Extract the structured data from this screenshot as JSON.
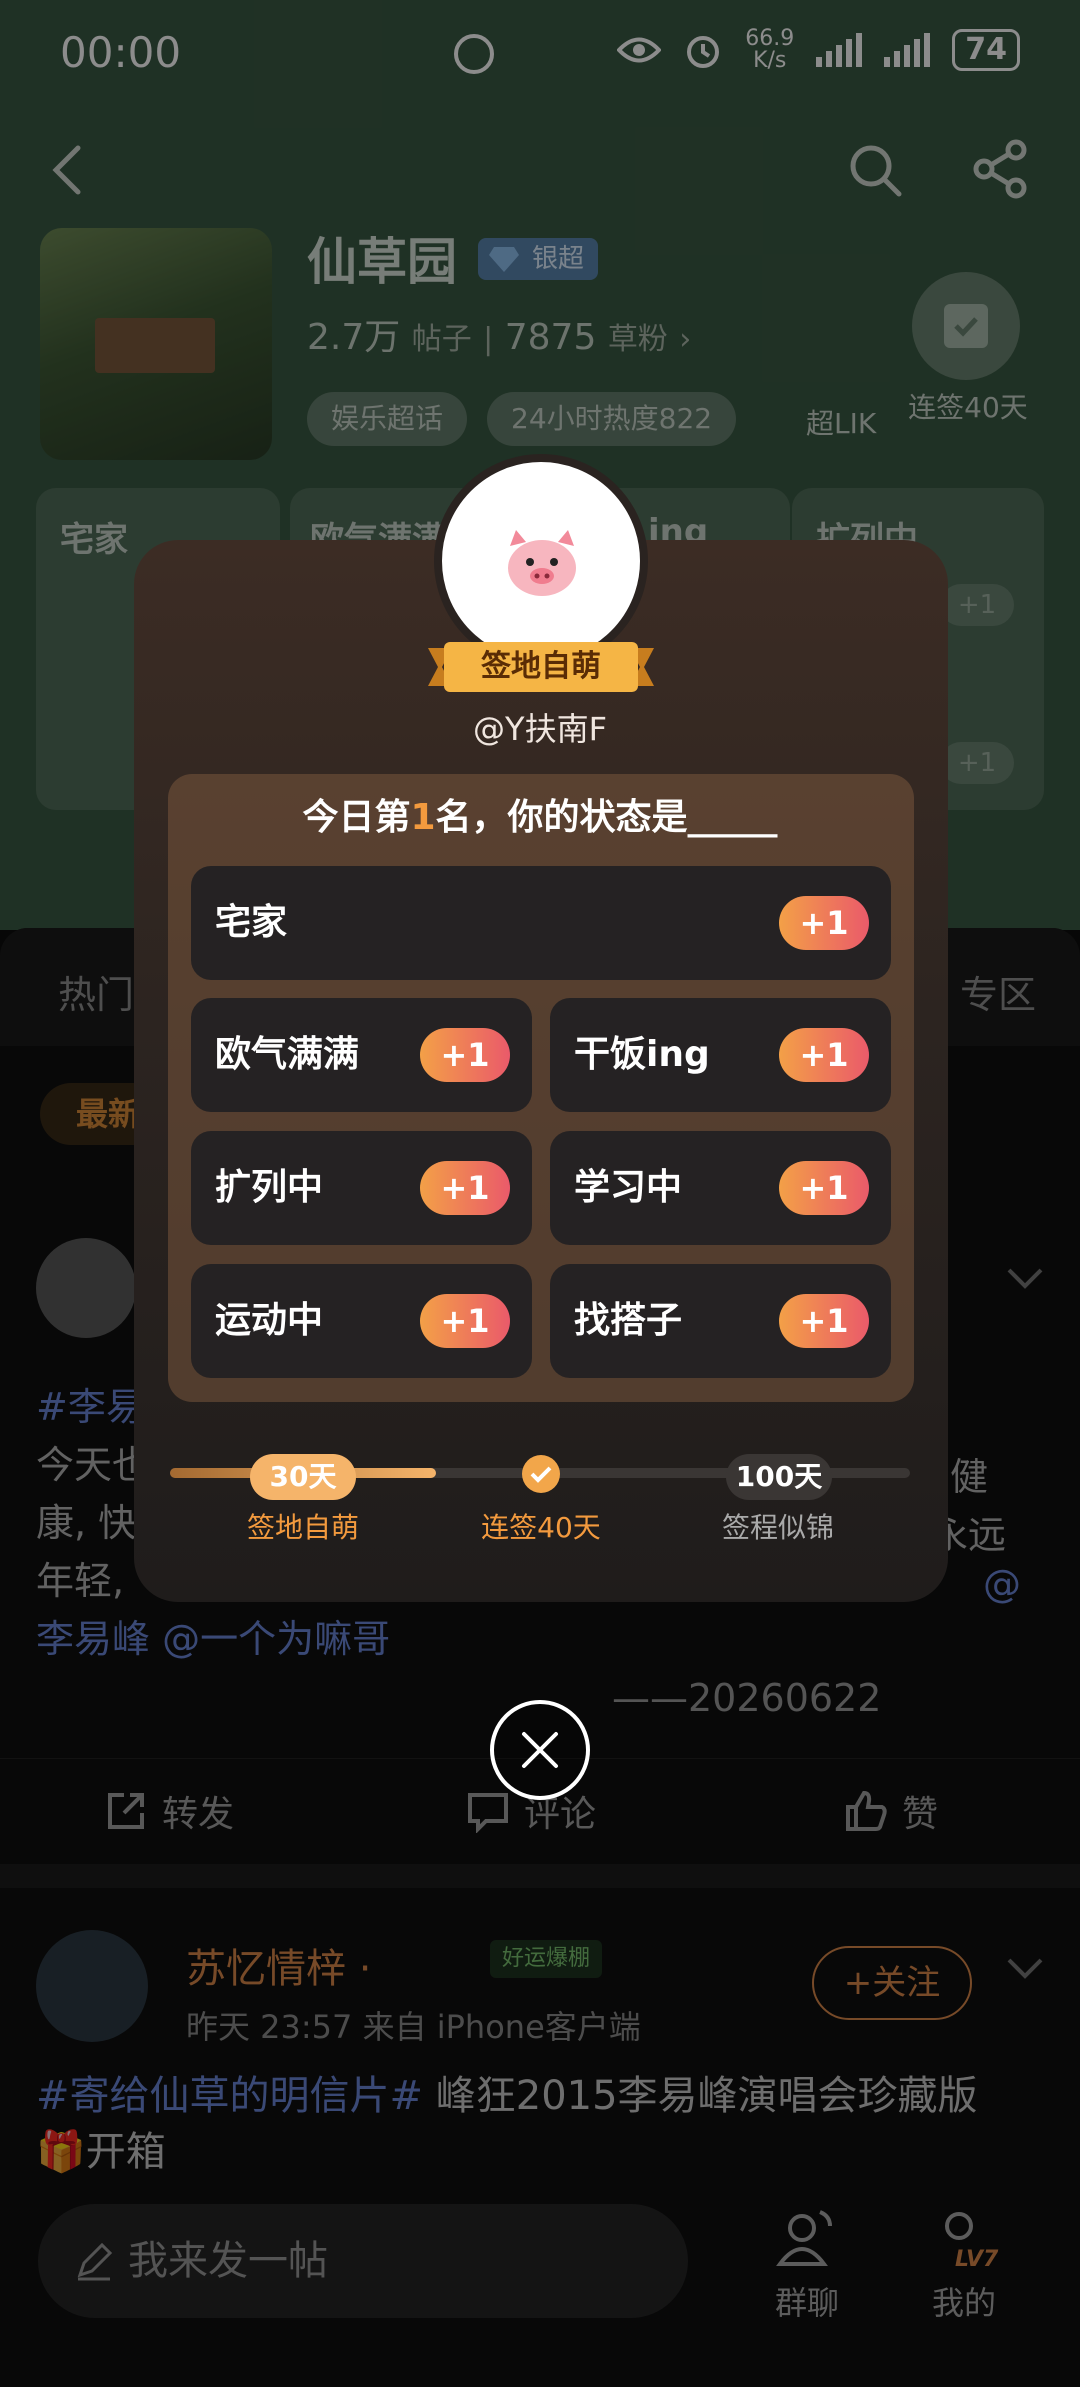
{
  "status_bar": {
    "time": "00:00",
    "speed": "66.9\nK/s",
    "speed_top": "66.9",
    "speed_bottom": "K/s",
    "battery": "74"
  },
  "community": {
    "title": "仙草园",
    "badge": "银超",
    "posts_count": "2.7万",
    "posts_label": "帖子",
    "fans_count": "7875",
    "fans_label": "草粉",
    "fans_arrow": "›",
    "tags": [
      "娱乐超话",
      "24小时热度822"
    ],
    "chaolik": "超LIK",
    "checkin_label": "连签40天"
  },
  "background_cards": {
    "col1": "宅家",
    "col2": "欧气满满",
    "col2_tail": "ing",
    "col3": "扩列中",
    "plus": "+1"
  },
  "feed": {
    "tab_hot": "热门",
    "tab_zone": "专区",
    "chip_new": "最新",
    "post1": {
      "hashtag": "#李易",
      "line1": "今天也",
      "line1_right": "健",
      "line2": "康, 快",
      "line2_right": "永远",
      "line3": "年轻,",
      "mention_tail": "@",
      "line4": "李易峰 @一个为嘛哥",
      "date": "——20260622"
    },
    "actions": {
      "repost": "转发",
      "comment": "评论",
      "like": "赞"
    },
    "post2": {
      "name": "苏忆情梓 ·",
      "lucky": "好运爆棚",
      "meta": "昨天 23:57  来自 iPhone客户端",
      "follow": "+关注",
      "hashtag": "#寄给仙草的明信片#",
      "text": " 峰狂2015李易峰演唱会珍藏版",
      "text2": "🎁开箱"
    }
  },
  "bottom_bar": {
    "compose_placeholder": "我来发一帖",
    "group_chat": "群聊",
    "mine": "我的",
    "level": "LV7"
  },
  "modal": {
    "ribbon": "签地自萌",
    "username": "@Y扶南F",
    "question_pre": "今日第",
    "rank": "1",
    "question_post": "名，你的状态是_____",
    "options": [
      {
        "label": "宅家",
        "plus": "+1"
      },
      {
        "label": "欧气满满",
        "plus": "+1"
      },
      {
        "label": "干饭ing",
        "plus": "+1"
      },
      {
        "label": "扩列中",
        "plus": "+1"
      },
      {
        "label": "学习中",
        "plus": "+1"
      },
      {
        "label": "运动中",
        "plus": "+1"
      },
      {
        "label": "找搭子",
        "plus": "+1"
      }
    ],
    "timeline": {
      "progress": 0.36,
      "node_30": "30天",
      "node_100": "100天",
      "label_30": "签地自萌",
      "label_40": "连签40天",
      "label_100": "签程似锦"
    }
  },
  "colors": {
    "accent_orange": "#f39a3e",
    "plus_gradient_start": "#f3a047",
    "plus_gradient_end": "#ea5a6a",
    "hashtag_blue": "#6a86d8"
  }
}
